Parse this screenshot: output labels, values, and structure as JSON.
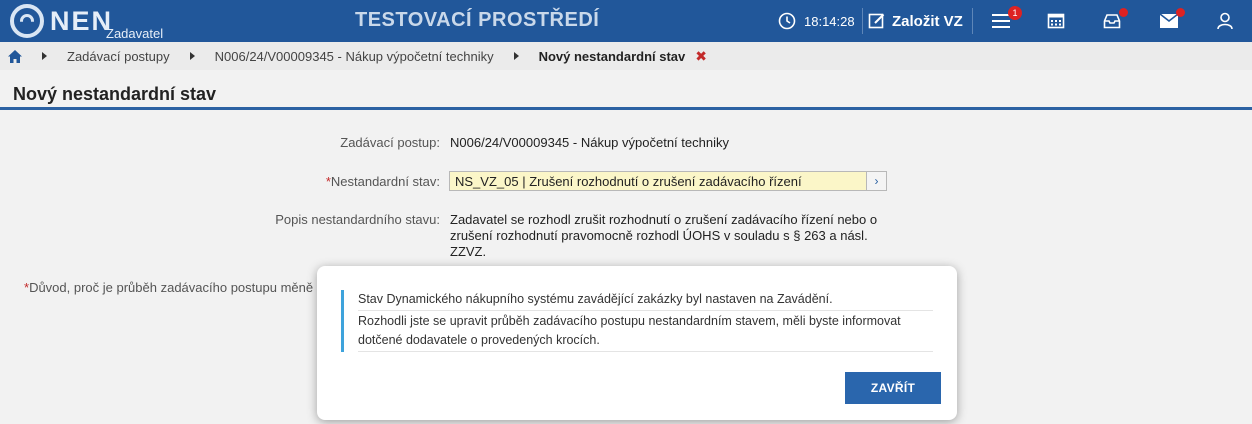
{
  "header": {
    "logo_text": "NEN",
    "logo_sub": "Zadavatel",
    "env_title": "TESTOVACÍ PROSTŘEDÍ",
    "time": "18:14:28",
    "create_label": "Založit VZ",
    "menu_badge": "1"
  },
  "breadcrumb": {
    "items": [
      "Zadávací postupy",
      "N006/24/V00009345 - Nákup výpočetní techniky"
    ],
    "current": "Nový nestandardní stav",
    "close_glyph": "✖"
  },
  "page": {
    "title": "Nový nestandardní stav"
  },
  "form": {
    "procedure_label": "Zadávací postup:",
    "procedure_value": "N006/24/V00009345 - Nákup výpočetní techniky",
    "state_label": "Nestandardní stav:",
    "state_value": "NS_VZ_05 | Zrušení rozhodnutí o zrušení zadávacího řízení",
    "desc_label": "Popis nestandardního stavu:",
    "desc_value": "Zadavatel se rozhodl zrušit rozhodnutí o zrušení zadávacího řízení nebo o zrušení rozhodnutí pravomocně rozhodl ÚOHS v souladu s § 263 a násl. ZZVZ.",
    "reason_label": "Důvod, proč je průběh zadávacího postupu měně",
    "required_mark": "*"
  },
  "modal": {
    "line1": "Stav Dynamického nákupního systému zavádějící zakázky byl nastaven na Zavádění.",
    "line2": "Rozhodli jste se upravit průběh zadávacího postupu nestandardním stavem, měli byste informovat dotčené dodavatele o provedených krocích.",
    "close_label": "ZAVŘÍT"
  }
}
